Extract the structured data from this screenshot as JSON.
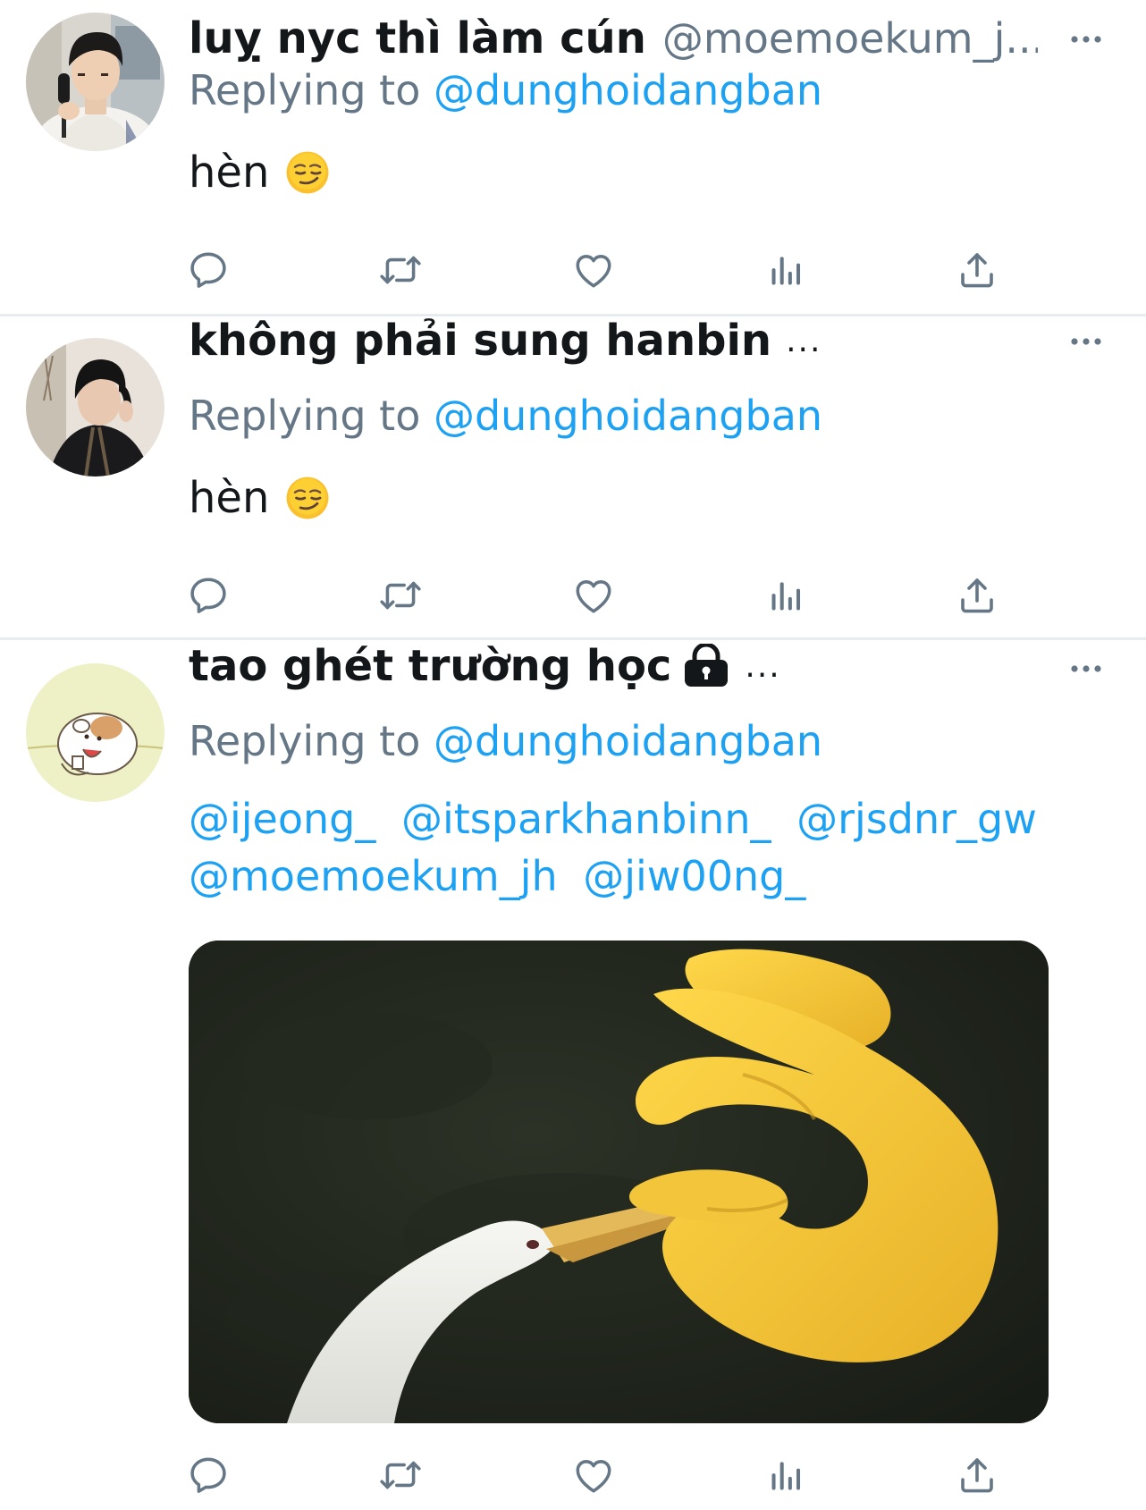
{
  "tweets": [
    {
      "display_name": "luỵ nyc thì làm cún",
      "handle": "@moemoekum_j...",
      "replying_prefix": "Replying to",
      "replying_to": "@dunghoidangban",
      "text": "hèn",
      "emoji": "smirking-face"
    },
    {
      "display_name": "không phải sung hanbin",
      "name_truncation": "...",
      "replying_prefix": "Replying to",
      "replying_to": "@dunghoidangban",
      "text": "hèn",
      "emoji": "smirking-face"
    },
    {
      "display_name": "tao ghét trường học",
      "name_truncation": "...",
      "locked": true,
      "replying_prefix": "Replying to",
      "replying_to": "@dunghoidangban",
      "mentions": [
        "@ijeong_",
        "@itsparkhanbinn_",
        "@rjsdnr_gw",
        "@moemoekum_jh",
        "@jiw00ng_"
      ],
      "media": "photo of a white goose beak pinched by a cartoon yellow hand emoji"
    }
  ],
  "icons": {
    "reply": "reply-icon",
    "retweet": "retweet-icon",
    "like": "like-icon",
    "analytics": "analytics-icon",
    "share": "share-icon",
    "more": "more-icon"
  },
  "colors": {
    "link": "#1da1f2",
    "secondary_text": "#657786",
    "icon": "#657786",
    "divider": "#e6ecf0"
  }
}
